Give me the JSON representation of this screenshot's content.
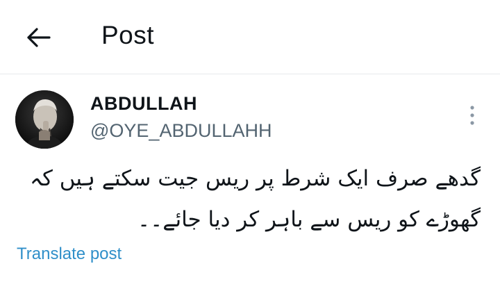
{
  "header": {
    "back_icon": "arrow-left-icon",
    "title": "Post"
  },
  "post": {
    "author": {
      "display_name": "ABDULLAH",
      "handle": "@OYE_ABDULLAHH",
      "avatar": "avatar-photo"
    },
    "more_icon": "more-vertical-icon",
    "text": "گدھے صرف ایک شرط پر ریس جیت سکتے ہیں کہ\nگھوڑے کو ریس سے باہر کر دیا جائے۔۔",
    "translate_label": "Translate post"
  },
  "colors": {
    "background": "#ffffff",
    "text_primary": "#0f1419",
    "text_secondary": "#536471",
    "link": "#2f8fc9",
    "divider": "#e6e9ec"
  }
}
